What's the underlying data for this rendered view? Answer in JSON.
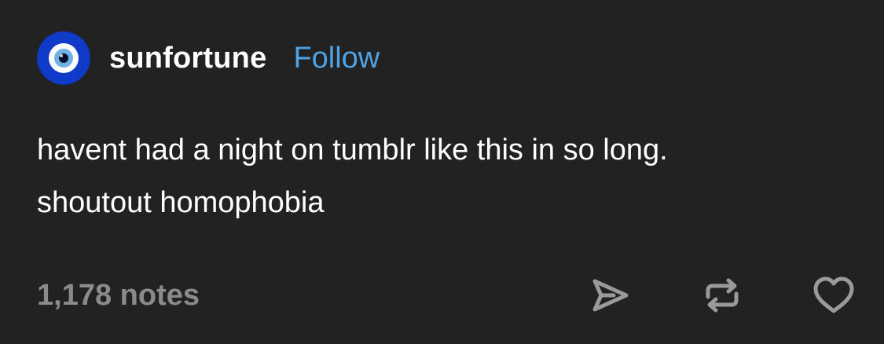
{
  "post": {
    "author": "sunfortune",
    "follow_label": "Follow",
    "avatar_icon": "evil-eye-icon",
    "body_lines": [
      "havent had a night on tumblr like this in so long.",
      "shoutout homophobia"
    ],
    "notes_label": "1,178 notes",
    "actions": [
      {
        "icon": "share-icon"
      },
      {
        "icon": "reblog-icon"
      },
      {
        "icon": "heart-icon"
      }
    ]
  },
  "colors": {
    "background": "#222222",
    "text": "#ffffff",
    "follow": "#4da3e6",
    "muted": "#8b8b8b",
    "avatar_blue": "#0f39c4"
  }
}
